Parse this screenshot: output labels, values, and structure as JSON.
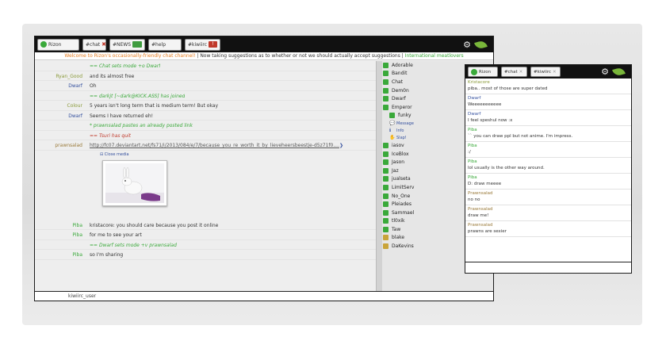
{
  "main": {
    "tabs": [
      {
        "label": "Rizon",
        "kind": "network"
      },
      {
        "label": "#chat",
        "kind": "channel-close"
      },
      {
        "label": "#NEWS",
        "kind": "channel-activity"
      },
      {
        "label": "#help",
        "kind": "channel"
      },
      {
        "label": "#kiwiirc",
        "kind": "channel-alert"
      }
    ],
    "topic": {
      "part1": "Welcome to Rizon's occasionally-friendly chat channel!",
      "part2": " | Now taking suggestions as to whether or not we should actually accept suggestions | ",
      "part3": "International meatlovers"
    },
    "messages": [
      {
        "nick": "",
        "text": "== Chat sets mode +o Dwarf",
        "style": "act"
      },
      {
        "nick": "Ryan_Good",
        "nick_color": "n-olive",
        "text": "and its almost free"
      },
      {
        "nick": "Dwarf",
        "nick_color": "n-blue",
        "text": "Oh"
      },
      {
        "nick": "",
        "text": "== darkjt [~dark@KICK.ASS] has joined",
        "style": "act"
      },
      {
        "nick": "Colour",
        "nick_color": "n-olive",
        "text": "5 years isn't long term that is medium term! But okay"
      },
      {
        "nick": "Dwarf",
        "nick_color": "n-blue",
        "text": "Seems I have returned eh!"
      },
      {
        "nick": "",
        "text": "* prawnsalad  pastes an already posted link",
        "style": "act"
      },
      {
        "nick": "",
        "text": "== Tsuri has quit",
        "style": "quit"
      },
      {
        "nick": "prawnsalad",
        "nick_color": "n-brown",
        "text": "http://fc07.deviantart.net/fs71/i/2013/084/e/7/because_you_re_worth_it_by_lieveheersbeestje-d5z71f0....",
        "style": "link"
      }
    ],
    "close_media": "Close media",
    "messages_after": [
      {
        "nick": "Piba",
        "nick_color": "n-green",
        "text": "kristacore:  you should care because you post it online"
      },
      {
        "nick": "Piba",
        "nick_color": "n-green",
        "text": "for me to see your art"
      },
      {
        "nick": "",
        "text": "== Dwarf sets mode +v prawnsalad",
        "style": "act"
      },
      {
        "nick": "Piba",
        "nick_color": "n-green",
        "text": "so I'm sharing"
      }
    ],
    "nicklist": [
      "Adorable",
      "Bandit",
      "Chat",
      "Dem0n",
      "Dwarf",
      "Emperor"
    ],
    "nicklist_selected": "funky",
    "nick_actions": [
      {
        "icon": "speech-icon",
        "label": "Message"
      },
      {
        "icon": "info-icon",
        "label": "Info"
      },
      {
        "icon": "slap-icon",
        "label": "Slap!"
      }
    ],
    "nicklist_rest": [
      "iasov",
      "IceBlox",
      "Jason",
      "Jaz",
      "jualseta",
      "LimitServ",
      "No_One",
      "Pleiades",
      "Sammael",
      "tl0xik",
      "Taw",
      "blake",
      "DaKevins"
    ],
    "nicklist_yellow": [
      "blake",
      "DaKevins"
    ],
    "input_nick": "kiwiirc_user"
  },
  "secondary": {
    "tabs": [
      {
        "label": "Rizon",
        "kind": "network"
      },
      {
        "label": "#chat",
        "kind": "channel-muted"
      },
      {
        "label": "#kiwiirc",
        "kind": "channel-muted"
      }
    ],
    "messages": [
      {
        "nick": "Kristacore",
        "nick_color": "n-olive",
        "text": "piba.. most of those are super dated"
      },
      {
        "nick": "Dwarf",
        "nick_color": "n-blue",
        "text": "Weeeeeeeeeee"
      },
      {
        "nick": "Dwarf",
        "nick_color": "n-blue",
        "text": "I feel speshul now :x"
      },
      {
        "nick": "Piba",
        "nick_color": "n-green",
        "text": "`` you can draw ppl but not anime. I'm impress."
      },
      {
        "nick": "Piba",
        "nick_color": "n-green",
        "text": ":/"
      },
      {
        "nick": "Piba",
        "nick_color": "n-green",
        "text": "lol usually is the other way around."
      },
      {
        "nick": "Piba",
        "nick_color": "n-green",
        "text": "D: draw meeee"
      },
      {
        "nick": "Prawnsalad",
        "nick_color": "n-brown",
        "text": "no no"
      },
      {
        "nick": "Prawnsalad",
        "nick_color": "n-brown",
        "text": "draw me!"
      },
      {
        "nick": "Prawnsalad",
        "nick_color": "n-brown",
        "text": "prawns are sexier"
      }
    ]
  },
  "colors": {
    "accent_green": "#3aa93a",
    "toolbar_bg": "#111111",
    "alert_red": "#c0392b",
    "action_green": "#3aa93a"
  }
}
